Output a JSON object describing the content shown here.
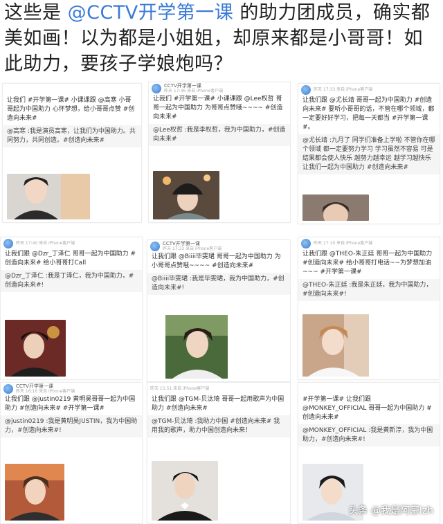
{
  "headline": {
    "prefix": "这些是 ",
    "mention": "@CCTV开学第一课",
    "rest": " 的助力团成员，确实都美如画！以为都是小姐姐，却原来都是小哥哥！如此助力，要孩子学娘炮吗？"
  },
  "posts": [
    {
      "account": "",
      "time": "",
      "body": "让我们 #开学第一课# 小课课跟 @高寒 小哥哥起为中国助力 心怀梦想，给小哥哥点赞 #创造向未来#",
      "repost": "@高寒 :我是演员高寒，让我们为中国助力。共同努力，共同创造。#创造向未来#"
    },
    {
      "account": "CCTV开学第一课",
      "time": "昨天 17:46 来自 iPhone客户端",
      "body": "让我们 #开学第一课# 小课课跟 @Lee权哲 哥哥一起为中国助力 为哥哥点赞哦~~~~ #创造向未来#",
      "repost": "@Lee权哲 :我是李权哲，我为中国助力，#创造向未来#"
    },
    {
      "account": "",
      "time": "昨天 17:33 来自 iPhone客户端",
      "body": "让我们跟 @尤长靖 哥哥一起为中国助力 #创造向未来# 要听小哥哥的话，不管在哪个领域，都一定要好好学习，把每一天都当 #开学第一课#。",
      "repost": "@尤长靖 :九月了 同学们准备上学啦 不管你在哪个领域 都一定要努力学习 学习虽然不容易 可是结果都会使人快乐 越努力越幸运 越学习越快乐 让我们一起为中国助力 #创造向未来#"
    },
    {
      "account": "",
      "time": "昨天 17:40 来自 iPhone客户端",
      "body": "让我们跟 @Dzr_丁泽仁 哥哥一起为中国助力 #创造向未来# 给小哥哥打Call",
      "repost": "@Dzr_丁泽仁 :我是丁泽仁，我为中国助力，#创造向未来#!"
    },
    {
      "account": "CCTV开学第一课",
      "time": "昨天 17:33 来自 iPhone客户端",
      "body": "让我们跟 @Biiii毕雯珺 哥哥一起为中国助力 为小哥哥点赞哦~~~~ #创造向未来#",
      "repost": "@Biiii毕雯珺 :我是毕雯珺，我为中国助力，#创造向未来#!"
    },
    {
      "account": "",
      "time": "昨天 17:10 来自 iPhone客户端",
      "body": "让我们跟 @THEO-朱正廷 哥哥一起为中国助力 #创造向未来# 给小哥哥打电话~~为梦想加油~~~ #开学第一课#",
      "repost": "@THEO-朱正廷 :我是朱正廷，我为中国助力，#创造向未来#!"
    },
    {
      "account": "CCTV开学第一课",
      "time": "昨天 16:16 来自 iPhone客户端",
      "body": "让我们跟 @justin0219 黄明昊哥哥一起为中国助力 #创造向未来# #开学第一课#",
      "repost": "@justin0219 :我是黄明昊JUSTIN，我为中国助力，#创造向未来#!"
    },
    {
      "account": "",
      "time": "昨天 15:51 来自 iPhone客户端",
      "body": "让我们跟 @TGM-贝汰琦 哥哥一起用歌声为中国助力 #创造向未来#",
      "repost": "@TGM-贝汰琦 :我助力中国 #创造向未来# 我用我的歌声，助力中国创造向未来！"
    },
    {
      "account": "",
      "time": "",
      "body": "#开学第一课# 让我们跟 @MONKEY_OFFICIAL 哥哥一起为中国助力 #创造向未来#",
      "repost": "@MONKEY_OFFICIAL :我是黄新淳，我为中国助力，#创造向未来#!"
    }
  ],
  "watermark": "头条 @我是阿豪lzh"
}
